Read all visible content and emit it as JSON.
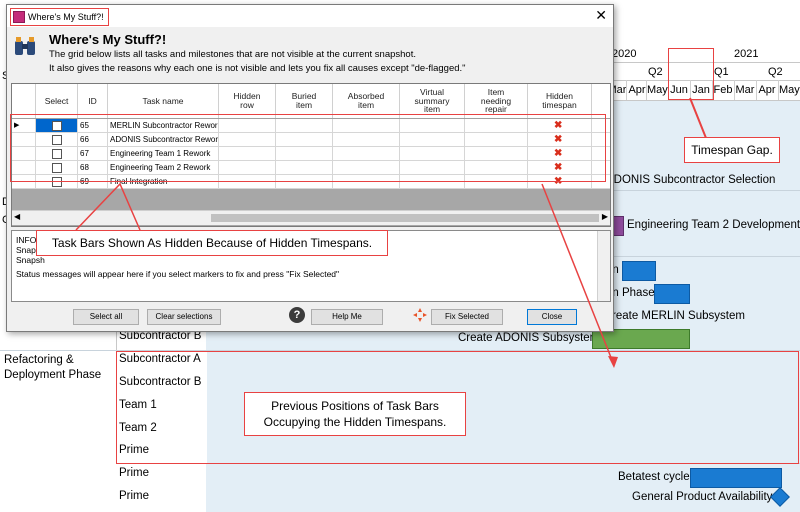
{
  "timeline": {
    "years": [
      "2020",
      "2021"
    ],
    "quarters": [
      "Q2",
      "Q1",
      "Q2"
    ],
    "months": [
      "Mar",
      "Apr",
      "May",
      "Jun",
      "Jan",
      "Feb",
      "Mar",
      "Apr",
      "May"
    ]
  },
  "gantt": {
    "phase_refactoring": "Refactoring &\nDeployment Phase",
    "groups": [
      "Subcontractor B",
      "Subcontractor A",
      "Subcontractor B",
      "Team 1",
      "Team 2",
      "Prime",
      "Prime",
      "Prime"
    ],
    "task_adonis_selection": "ADONIS Subcontractor Selection",
    "task_eng2_dev": "Engineering Team 2 Development",
    "task_on": "on",
    "task_on_phase": "on Phase",
    "task_create_merlin": "reate MERLIN Subsystem",
    "task_create_adonis": "Create ADONIS Subsystem",
    "task_betatest": "Betatest cycle",
    "task_gpa": "General Product Availability",
    "left_frag_1": "D",
    "left_frag_2": "C",
    "left_frag_3": "S",
    "colors": {
      "bar_blue": "#1a7bd2",
      "bar_green": "#6aa84f",
      "bar_purple": "#8e4b9c",
      "chart_bg": "#e3eef6"
    }
  },
  "dialog": {
    "window_title": "Where's My Stuff?!",
    "heading": "Where's My Stuff?!",
    "desc1": "The grid below lists all tasks and milestones that are not visible at the current snapshot.",
    "desc2": "It also gives the reasons why each one is not visible and lets you fix all causes except \"de-flagged.\"",
    "columns": [
      "Select",
      "ID",
      "Task name",
      "Hidden row",
      "Buried item",
      "Absorbed item",
      "Virtual summary item",
      "Item needing repair",
      "Hidden timespan"
    ],
    "rows": [
      {
        "id": "65",
        "name": "MERLIN Subcontractor Rework",
        "hidden_timespan": "✖"
      },
      {
        "id": "66",
        "name": "ADONIS Subcontractor Rework",
        "hidden_timespan": "✖"
      },
      {
        "id": "67",
        "name": "Engineering Team 1 Rework",
        "hidden_timespan": "✖"
      },
      {
        "id": "68",
        "name": "Engineering Team 2 Rework",
        "hidden_timespan": "✖"
      },
      {
        "id": "69",
        "name": "Final Integration",
        "hidden_timespan": "✖"
      }
    ],
    "status_line1": "INFOR",
    "status_line2": "Snaps",
    "status_line3": "Snapsh",
    "status_message": "Status messages will appear here if you select markers to fix and press \"Fix Selected\"",
    "buttons": {
      "select_all": "Select all",
      "clear_selections": "Clear selections",
      "help_me": "Help Me",
      "fix_selected": "Fix Selected",
      "close": "Close"
    }
  },
  "annotations": {
    "timespan_gap": "Timespan Gap.",
    "task_bars_hidden": "Task Bars Shown As Hidden Because of Hidden Timespans.",
    "previous_positions": "Previous Positions of Task Bars\nOccupying the Hidden Timespans."
  }
}
